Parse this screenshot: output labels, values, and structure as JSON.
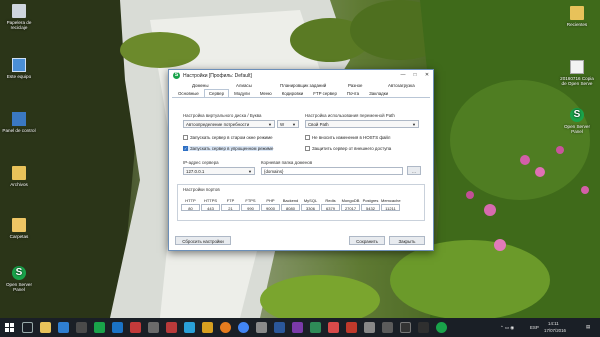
{
  "desktop": {
    "icons_left": [
      {
        "name": "recycle-bin-icon",
        "label": "Papelera de reciclaje"
      },
      {
        "name": "computer-icon",
        "label": "Este equipo"
      },
      {
        "name": "control-panel-icon",
        "label": "Panel de control"
      },
      {
        "name": "folder-icon",
        "label": "Archivos"
      },
      {
        "name": "folder-icon",
        "label": "Carpetas"
      },
      {
        "name": "openserver-icon",
        "label": "Open Server Panel"
      }
    ],
    "icons_right": [
      {
        "name": "folder-icon",
        "label": "Recientes"
      },
      {
        "name": "file-icon",
        "label": "20160716 Copia de Open Serve"
      },
      {
        "name": "openserver-icon",
        "label": "Open Server Panel"
      }
    ]
  },
  "dialog": {
    "title": "Настройки [Профиль: Default]",
    "icon_letter": "S",
    "controls": {
      "minimize": "—",
      "maximize": "□",
      "close": "✕"
    },
    "tabs_row1": [
      "Домены",
      "Алиасы",
      "Планировщик заданий",
      "Разное",
      "Автозагрузка"
    ],
    "tabs_row2": [
      "Основные",
      "Сервер",
      "Модули",
      "Меню",
      "Кодировки",
      "FTP сервер",
      "Почта",
      "Закладки"
    ],
    "active_tab": "Сервер",
    "virtual_disk_label": "Настройка виртуального диска / Буква",
    "virtual_disk_value": "Автоопределение потребности",
    "virtual_disk_letter": "W",
    "path_var_label": "Настройка использования переменной Path",
    "path_var_value": "Свой Path",
    "chk_start_old": "Запускать сервер в старом окне режиме",
    "chk_hosts": "Не вносить изменения в HOSTS файл",
    "chk_autostart": "Запускать сервер в упрощенном режиме",
    "chk_protect": "Защитить сервер от внешнего доступа",
    "ip_label": "IP-адрес сервера",
    "ip_value": "127.0.0.1",
    "root_label": "Корневая папка доменов",
    "root_value": "{domains}",
    "browse": "...",
    "ports_group_label": "Настройки портов",
    "ports": [
      {
        "name": "HTTP",
        "value": "80"
      },
      {
        "name": "HTTPS",
        "value": "443"
      },
      {
        "name": "FTP",
        "value": "21"
      },
      {
        "name": "FTPS",
        "value": "990"
      },
      {
        "name": "PHP",
        "value": "9000"
      },
      {
        "name": "Backend",
        "value": "8080"
      },
      {
        "name": "MySQL",
        "value": "3306"
      },
      {
        "name": "Redis",
        "value": "6379"
      },
      {
        "name": "MongoDB",
        "value": "27017"
      },
      {
        "name": "Postgres",
        "value": "5432"
      },
      {
        "name": "Memcache",
        "value": "11211"
      }
    ],
    "reset_button": "Сбросить настройки",
    "save_button": "Сохранить",
    "close_button": "Закрыть"
  },
  "taskbar": {
    "lang": "ESP",
    "time": "14:11",
    "date": "17/07/2016"
  }
}
